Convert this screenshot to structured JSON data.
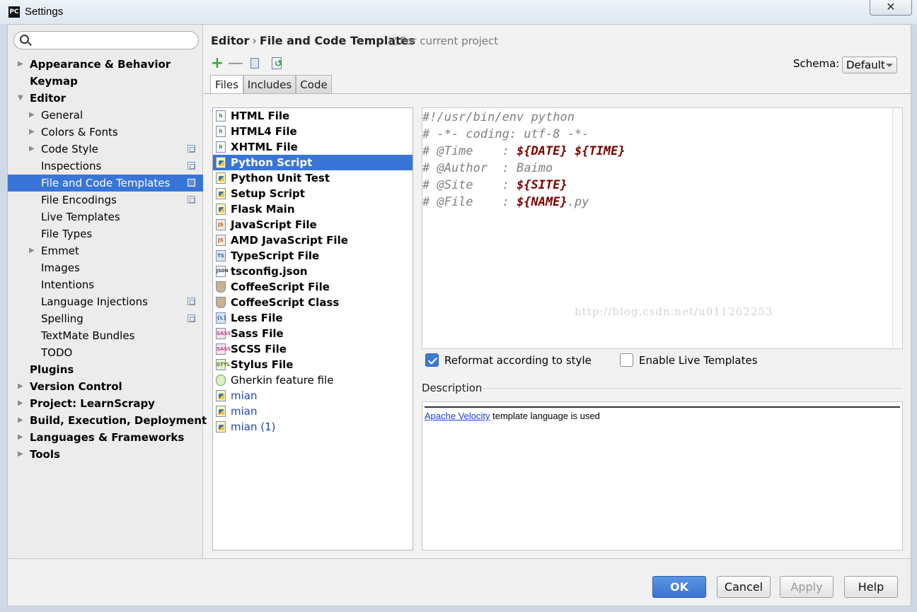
{
  "window": {
    "title": "Settings",
    "app_icon": "PC"
  },
  "search": {
    "placeholder": ""
  },
  "sidebar": {
    "items": [
      {
        "label": "Appearance & Behavior",
        "level": 0,
        "bold": true,
        "expandable": true,
        "expanded": false,
        "project": false
      },
      {
        "label": "Keymap",
        "level": 0,
        "bold": true,
        "expandable": false,
        "project": false
      },
      {
        "label": "Editor",
        "level": 0,
        "bold": true,
        "expandable": true,
        "expanded": true,
        "project": false
      },
      {
        "label": "General",
        "level": 1,
        "bold": false,
        "expandable": true,
        "expanded": false,
        "project": false
      },
      {
        "label": "Colors & Fonts",
        "level": 1,
        "bold": false,
        "expandable": true,
        "expanded": false,
        "project": false
      },
      {
        "label": "Code Style",
        "level": 1,
        "bold": false,
        "expandable": true,
        "expanded": false,
        "project": true
      },
      {
        "label": "Inspections",
        "level": 1,
        "bold": false,
        "expandable": false,
        "project": true
      },
      {
        "label": "File and Code Templates",
        "level": 1,
        "bold": false,
        "expandable": false,
        "project": true,
        "selected": true
      },
      {
        "label": "File Encodings",
        "level": 1,
        "bold": false,
        "expandable": false,
        "project": true
      },
      {
        "label": "Live Templates",
        "level": 1,
        "bold": false,
        "expandable": false,
        "project": false
      },
      {
        "label": "File Types",
        "level": 1,
        "bold": false,
        "expandable": false,
        "project": false
      },
      {
        "label": "Emmet",
        "level": 1,
        "bold": false,
        "expandable": true,
        "expanded": false,
        "project": false
      },
      {
        "label": "Images",
        "level": 1,
        "bold": false,
        "expandable": false,
        "project": false
      },
      {
        "label": "Intentions",
        "level": 1,
        "bold": false,
        "expandable": false,
        "project": false
      },
      {
        "label": "Language Injections",
        "level": 1,
        "bold": false,
        "expandable": false,
        "project": true
      },
      {
        "label": "Spelling",
        "level": 1,
        "bold": false,
        "expandable": false,
        "project": true
      },
      {
        "label": "TextMate Bundles",
        "level": 1,
        "bold": false,
        "expandable": false,
        "project": false
      },
      {
        "label": "TODO",
        "level": 1,
        "bold": false,
        "expandable": false,
        "project": false
      },
      {
        "label": "Plugins",
        "level": 0,
        "bold": true,
        "expandable": false,
        "project": false
      },
      {
        "label": "Version Control",
        "level": 0,
        "bold": true,
        "expandable": true,
        "expanded": false,
        "project": false
      },
      {
        "label": "Project: LearnScrapy",
        "level": 0,
        "bold": true,
        "expandable": true,
        "expanded": false,
        "project": false
      },
      {
        "label": "Build, Execution, Deployment",
        "level": 0,
        "bold": true,
        "expandable": true,
        "expanded": false,
        "project": false
      },
      {
        "label": "Languages & Frameworks",
        "level": 0,
        "bold": true,
        "expandable": true,
        "expanded": false,
        "project": false
      },
      {
        "label": "Tools",
        "level": 0,
        "bold": true,
        "expandable": true,
        "expanded": false,
        "project": false
      }
    ]
  },
  "header": {
    "crumb_parent": "Editor",
    "crumb_sep": "›",
    "crumb_current": "File and Code Templates",
    "scope": "For current project"
  },
  "toolbar": {
    "add": "+",
    "remove": "—"
  },
  "schema": {
    "label": "Schema:",
    "value": "Default"
  },
  "tabs": [
    {
      "label": "Files",
      "active": true
    },
    {
      "label": "Includes",
      "active": false
    },
    {
      "label": "Code",
      "active": false
    }
  ],
  "templates": [
    {
      "label": "HTML File",
      "icon": "html-file-icon",
      "icon_text": "h",
      "kind": "html",
      "style": "bold"
    },
    {
      "label": "HTML4 File",
      "icon": "html-file-icon",
      "icon_text": "h",
      "kind": "html",
      "style": "bold"
    },
    {
      "label": "XHTML File",
      "icon": "html-file-icon",
      "icon_text": "h",
      "kind": "html",
      "style": "bold"
    },
    {
      "label": "Python Script",
      "icon": "python-file-icon",
      "icon_text": "",
      "kind": "py",
      "style": "bold",
      "selected": true
    },
    {
      "label": "Python Unit Test",
      "icon": "python-file-icon",
      "icon_text": "",
      "kind": "py",
      "style": "bold"
    },
    {
      "label": "Setup Script",
      "icon": "python-file-icon",
      "icon_text": "",
      "kind": "py",
      "style": "bold"
    },
    {
      "label": "Flask Main",
      "icon": "python-file-icon",
      "icon_text": "",
      "kind": "py",
      "style": "bold"
    },
    {
      "label": "JavaScript File",
      "icon": "javascript-file-icon",
      "icon_text": "JS",
      "kind": "js",
      "style": "bold"
    },
    {
      "label": "AMD JavaScript File",
      "icon": "javascript-file-icon",
      "icon_text": "JS",
      "kind": "js",
      "style": "bold"
    },
    {
      "label": "TypeScript File",
      "icon": "typescript-file-icon",
      "icon_text": "TS",
      "kind": "ts",
      "style": "bold"
    },
    {
      "label": "tsconfig.json",
      "icon": "json-file-icon",
      "icon_text": "JSON",
      "kind": "json",
      "style": "bold"
    },
    {
      "label": "CoffeeScript File",
      "icon": "coffeescript-file-icon",
      "icon_text": "",
      "kind": "coffee",
      "style": "bold"
    },
    {
      "label": "CoffeeScript Class",
      "icon": "coffeescript-file-icon",
      "icon_text": "",
      "kind": "coffee",
      "style": "bold"
    },
    {
      "label": "Less File",
      "icon": "less-file-icon",
      "icon_text": "{L}",
      "kind": "less",
      "style": "bold"
    },
    {
      "label": "Sass File",
      "icon": "sass-file-icon",
      "icon_text": "SASS",
      "kind": "sass",
      "style": "bold"
    },
    {
      "label": "SCSS File",
      "icon": "sass-file-icon",
      "icon_text": "SASS",
      "kind": "sass",
      "style": "bold"
    },
    {
      "label": "Stylus File",
      "icon": "stylus-file-icon",
      "icon_text": "STYL",
      "kind": "styl",
      "style": "bold"
    },
    {
      "label": "Gherkin feature file",
      "icon": "gherkin-file-icon",
      "icon_text": "",
      "kind": "gherkin",
      "style": "normal"
    },
    {
      "label": "mian",
      "icon": "python-file-icon",
      "icon_text": "",
      "kind": "py",
      "style": "link"
    },
    {
      "label": "mian",
      "icon": "python-file-icon",
      "icon_text": "",
      "kind": "py",
      "style": "link"
    },
    {
      "label": "mian (1)",
      "icon": "python-file-icon",
      "icon_text": "",
      "kind": "py",
      "style": "link"
    }
  ],
  "editor": {
    "lines": [
      [
        {
          "t": "#!/usr/bin/env python",
          "v": false
        }
      ],
      [
        {
          "t": "# -*- coding: utf-8 -*-",
          "v": false
        }
      ],
      [
        {
          "t": "# @Time    : ",
          "v": false
        },
        {
          "t": "${DATE}",
          "v": true
        },
        {
          "t": " ",
          "v": false
        },
        {
          "t": "${TIME}",
          "v": true
        }
      ],
      [
        {
          "t": "# @Author  : Baimo",
          "v": false
        }
      ],
      [
        {
          "t": "# @Site    : ",
          "v": false
        },
        {
          "t": "${SITE}",
          "v": true
        }
      ],
      [
        {
          "t": "# @File    : ",
          "v": false
        },
        {
          "t": "${NAME}",
          "v": true
        },
        {
          "t": ".py",
          "v": false
        }
      ]
    ],
    "watermark": "http://blog.csdn.net/u011262253"
  },
  "options": {
    "reformat_label": "Reformat according to style",
    "reformat_checked": true,
    "live_templates_label": "Enable Live Templates",
    "live_templates_checked": false
  },
  "description": {
    "label": "Description",
    "link_text": "Apache Velocity",
    "text": " template language is used"
  },
  "buttons": {
    "ok": "OK",
    "cancel": "Cancel",
    "apply": "Apply",
    "help": "Help"
  },
  "colors": {
    "selection": "#3875d7",
    "template_var": "#7a0000",
    "link": "#1e45b4",
    "accent_button": "#3a74cf"
  }
}
